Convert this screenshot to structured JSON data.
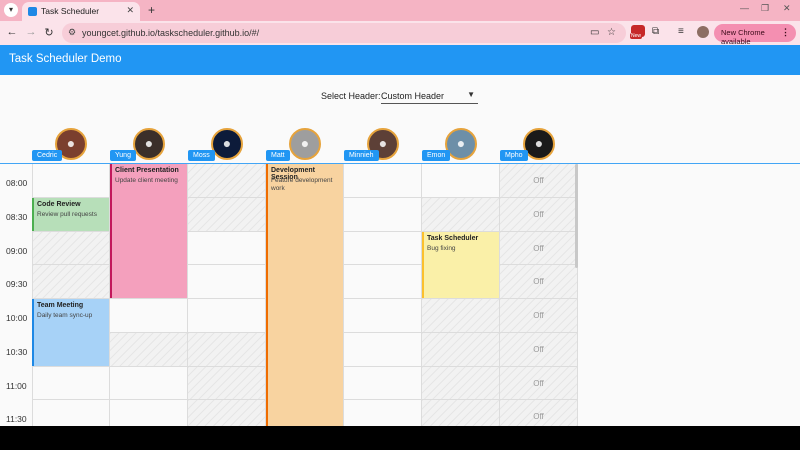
{
  "browser": {
    "tab_title": "Task Scheduler",
    "url": "youngcet.github.io/taskscheduler.github.io/#/",
    "update_label": "New Chrome available",
    "ext_badge": "New"
  },
  "app": {
    "title": "Task Scheduler Demo",
    "selector_label": "Select Header:",
    "selector_value": "Custom Header"
  },
  "resources": [
    {
      "name": "Cedric",
      "color": "#7b3f2e"
    },
    {
      "name": "Yung",
      "color": "#3b2f2a"
    },
    {
      "name": "Moss",
      "color": "#0d1b3a"
    },
    {
      "name": "Matt",
      "color": "#9e9e9e"
    },
    {
      "name": "Minnieh",
      "color": "#5d4037"
    },
    {
      "name": "Emon",
      "color": "#6d8fa8"
    },
    {
      "name": "Mpho",
      "color": "#1a1a1a"
    }
  ],
  "times": [
    "08:00",
    "08:30",
    "09:00",
    "09:30",
    "10:00",
    "10:30",
    "11:00",
    "11:30"
  ],
  "off_label": "Off",
  "events": [
    {
      "title": "Code Review",
      "desc": "Review pull requests",
      "color": "#b7dfb9",
      "border": "#4caf50"
    },
    {
      "title": "Client Presentation",
      "desc": "Update client meeting",
      "color": "#f4a0bd",
      "border": "#c2185b"
    },
    {
      "title": "Development Session",
      "desc": "Feature development work",
      "color": "#f8d3a0",
      "border": "#ef6c00"
    },
    {
      "title": "Task Scheduler",
      "desc": "Bug fixing",
      "color": "#faf0a8",
      "border": "#fbc02d"
    },
    {
      "title": "Team Meeting",
      "desc": "Daily team sync-up",
      "color": "#a7d2f7",
      "border": "#1e88e5"
    }
  ]
}
